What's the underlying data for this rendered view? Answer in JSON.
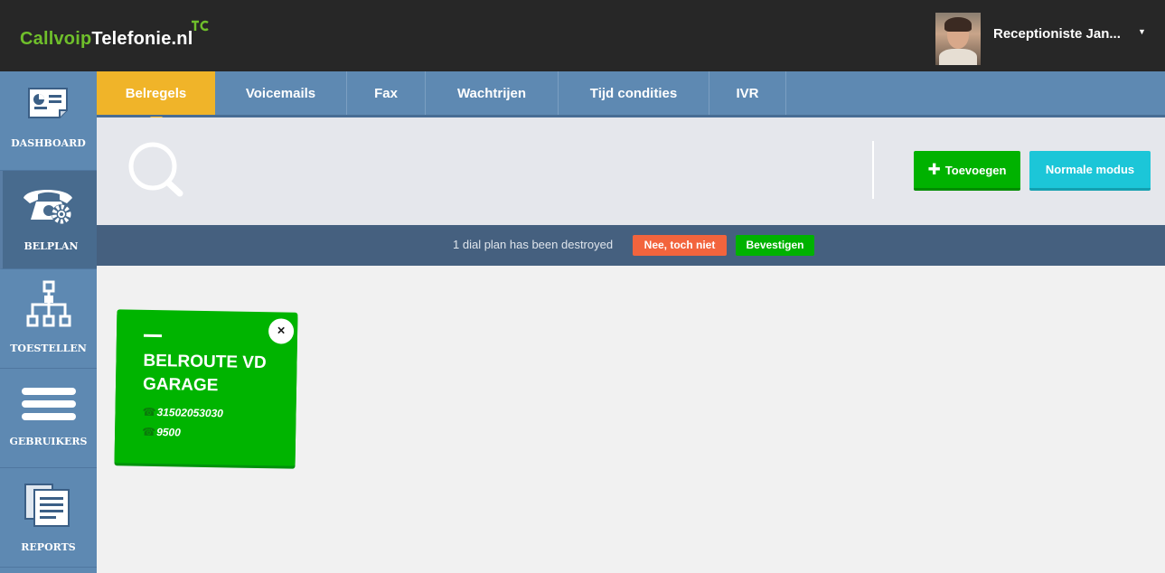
{
  "header": {
    "logo_part1": "Callvoip",
    "logo_part2": "Telefonie.nl",
    "user_name": "Receptioniste Jan..."
  },
  "sidebar": {
    "items": [
      {
        "label": "DASHBOARD",
        "icon": "dashboard-icon"
      },
      {
        "label": "BELPLAN",
        "icon": "phone-gear-icon"
      },
      {
        "label": "TOESTELLEN",
        "icon": "network-icon"
      },
      {
        "label": "GEBRUIKERS",
        "icon": "bars-icon"
      },
      {
        "label": "REPORTS",
        "icon": "documents-icon"
      }
    ],
    "active": "BELPLAN"
  },
  "tabs": [
    {
      "label": "Belregels"
    },
    {
      "label": "Voicemails"
    },
    {
      "label": "Fax"
    },
    {
      "label": "Wachtrijen"
    },
    {
      "label": "Tijd condities"
    },
    {
      "label": "IVR"
    }
  ],
  "toolbar": {
    "add_label": "Toevoegen",
    "mode_label": "Normale modus"
  },
  "notice": {
    "message": "1 dial plan has been destroyed",
    "undo_label": "Nee, toch niet",
    "confirm_label": "Bevestigen"
  },
  "cards": [
    {
      "title": "BELROUTE VD GARAGE",
      "numbers": [
        "31502053030",
        "9500"
      ],
      "close_symbol": "×"
    }
  ],
  "colors": {
    "header_bg": "#272727",
    "sidebar_bg": "#5e89b2",
    "active_tab": "#f0b429",
    "add_button": "#00b200",
    "mode_button": "#1cc6d8",
    "notice_bg": "#45607f",
    "undo_button": "#f2643d",
    "card_bg": "#00b400"
  }
}
